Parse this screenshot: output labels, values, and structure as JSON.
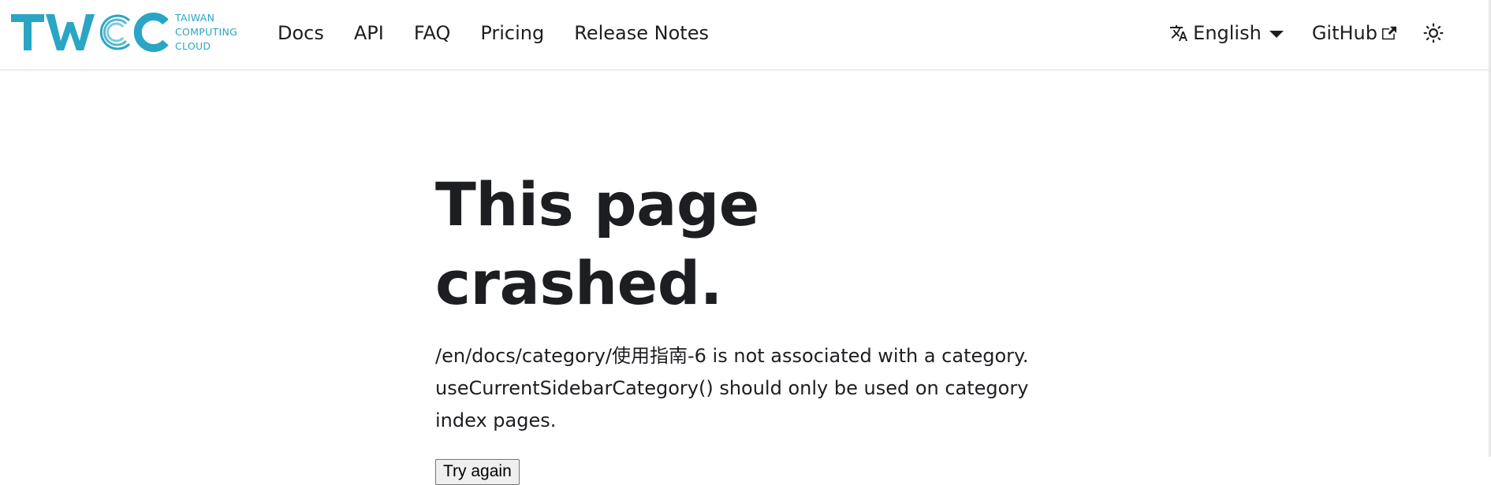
{
  "brand": {
    "logo_letters": "TWCC",
    "logo_text_lines": [
      "TAIWAN",
      "COMPUTING",
      "CLOUD"
    ],
    "accent_color": "#2aa6c4"
  },
  "nav": {
    "links": [
      "Docs",
      "API",
      "FAQ",
      "Pricing",
      "Release Notes"
    ],
    "language": {
      "label": "English",
      "icon": "translate-icon"
    },
    "github": {
      "label": "GitHub",
      "icon": "external-link-icon"
    },
    "theme_icon": "sun-icon"
  },
  "main": {
    "title": "This page crashed.",
    "message": "/en/docs/category/使用指南-6 is not associated with a category. useCurrentSidebarCategory() should only be used on category index pages.",
    "button_label": "Try again"
  }
}
